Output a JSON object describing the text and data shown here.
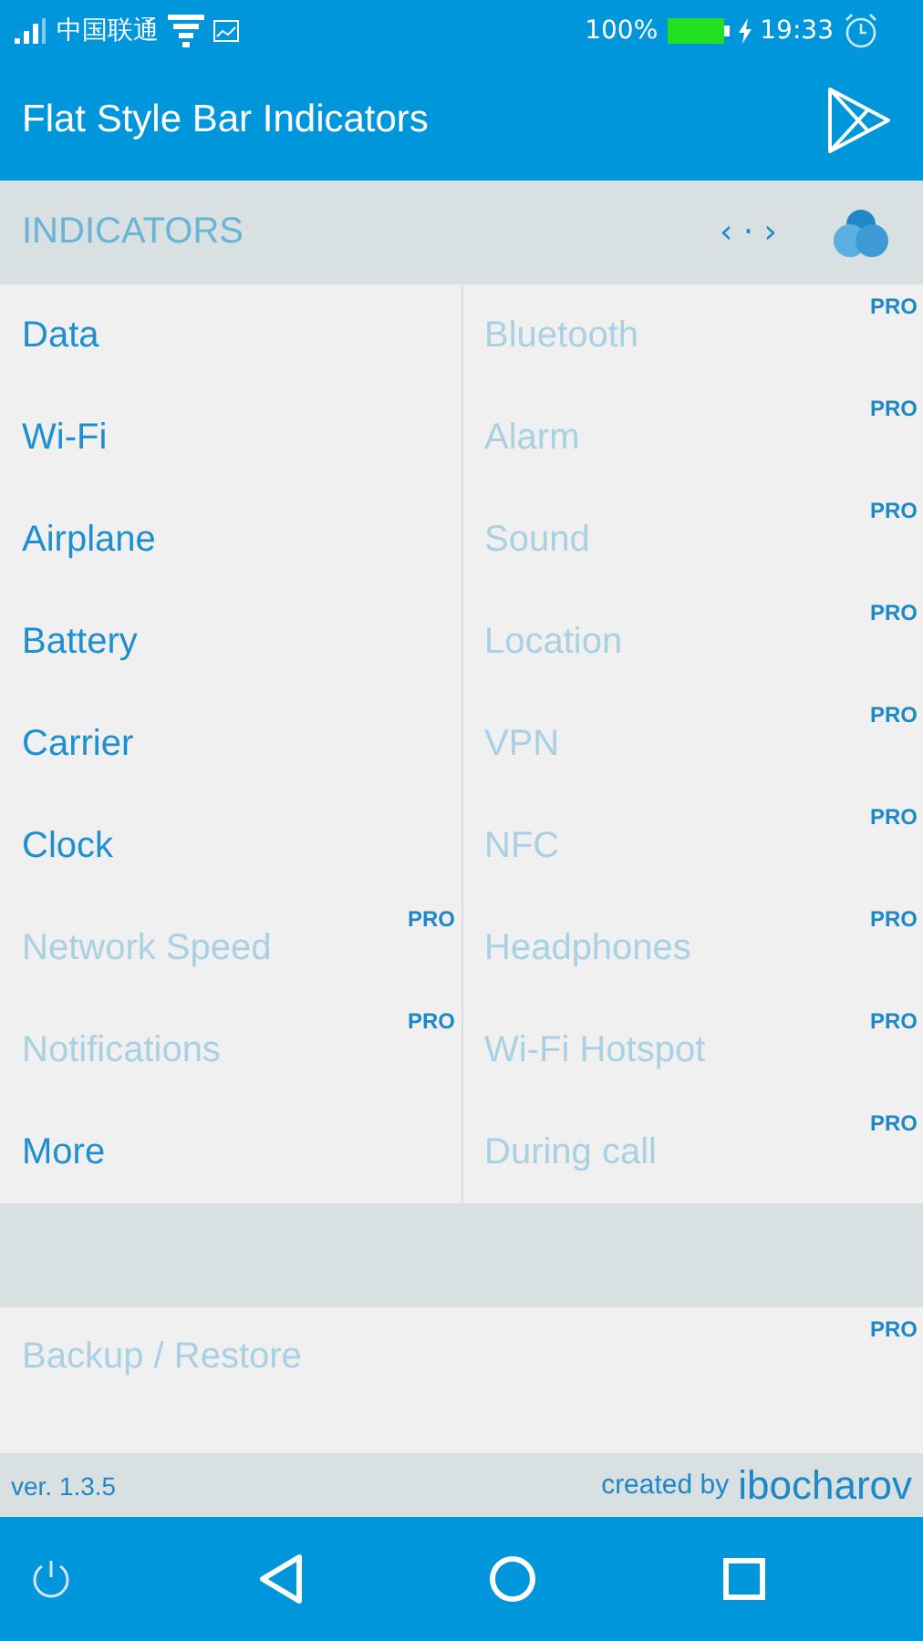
{
  "status_bar": {
    "carrier": "中国联通",
    "battery": "100%",
    "time": "19:33"
  },
  "app_bar": {
    "title": "Flat Style Bar Indicators"
  },
  "section": {
    "title": "INDICATORS",
    "nav_symbol": "‹ · ›"
  },
  "columns": [
    [
      {
        "label": "Data",
        "disabled": false
      },
      {
        "label": "Wi-Fi",
        "disabled": false
      },
      {
        "label": "Airplane",
        "disabled": false
      },
      {
        "label": "Battery",
        "disabled": false
      },
      {
        "label": "Carrier",
        "disabled": false
      },
      {
        "label": "Clock",
        "disabled": false
      },
      {
        "label": "Network Speed",
        "disabled": true,
        "badge": "PRO"
      },
      {
        "label": "Notifications",
        "disabled": true,
        "badge": "PRO"
      },
      {
        "label": "More",
        "disabled": false
      }
    ],
    [
      {
        "label": "Bluetooth",
        "disabled": true,
        "badge": "PRO"
      },
      {
        "label": "Alarm",
        "disabled": true,
        "badge": "PRO"
      },
      {
        "label": "Sound",
        "disabled": true,
        "badge": "PRO"
      },
      {
        "label": "Location",
        "disabled": true,
        "badge": "PRO"
      },
      {
        "label": "VPN",
        "disabled": true,
        "badge": "PRO"
      },
      {
        "label": "NFC",
        "disabled": true,
        "badge": "PRO"
      },
      {
        "label": "Headphones",
        "disabled": true,
        "badge": "PRO"
      },
      {
        "label": "Wi-Fi Hotspot",
        "disabled": true,
        "badge": "PRO"
      },
      {
        "label": "During call",
        "disabled": true,
        "badge": "PRO"
      }
    ]
  ],
  "extras": [
    {
      "label": "Backup / Restore",
      "disabled": true,
      "badge": "PRO"
    }
  ],
  "footer": {
    "version": "ver. 1.3.5",
    "credit_prefix": "created by",
    "author": "ibocharov"
  }
}
